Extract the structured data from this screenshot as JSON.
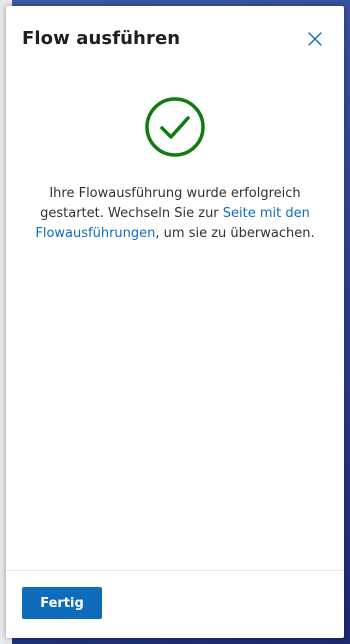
{
  "panel": {
    "title": "Flow ausführen",
    "close_icon": "close-icon"
  },
  "body": {
    "icon": "check-circle-icon",
    "icon_color": "#107c10",
    "message_part1": "Ihre Flowausführung wurde erfolgreich gestartet. Wechseln Sie zur ",
    "link_text": "Seite mit den Flowausführungen",
    "message_part2": ", um sie zu überwachen.",
    "link_color": "#0f6cbd"
  },
  "footer": {
    "done_label": "Fertig",
    "button_color": "#0f6cbd"
  }
}
